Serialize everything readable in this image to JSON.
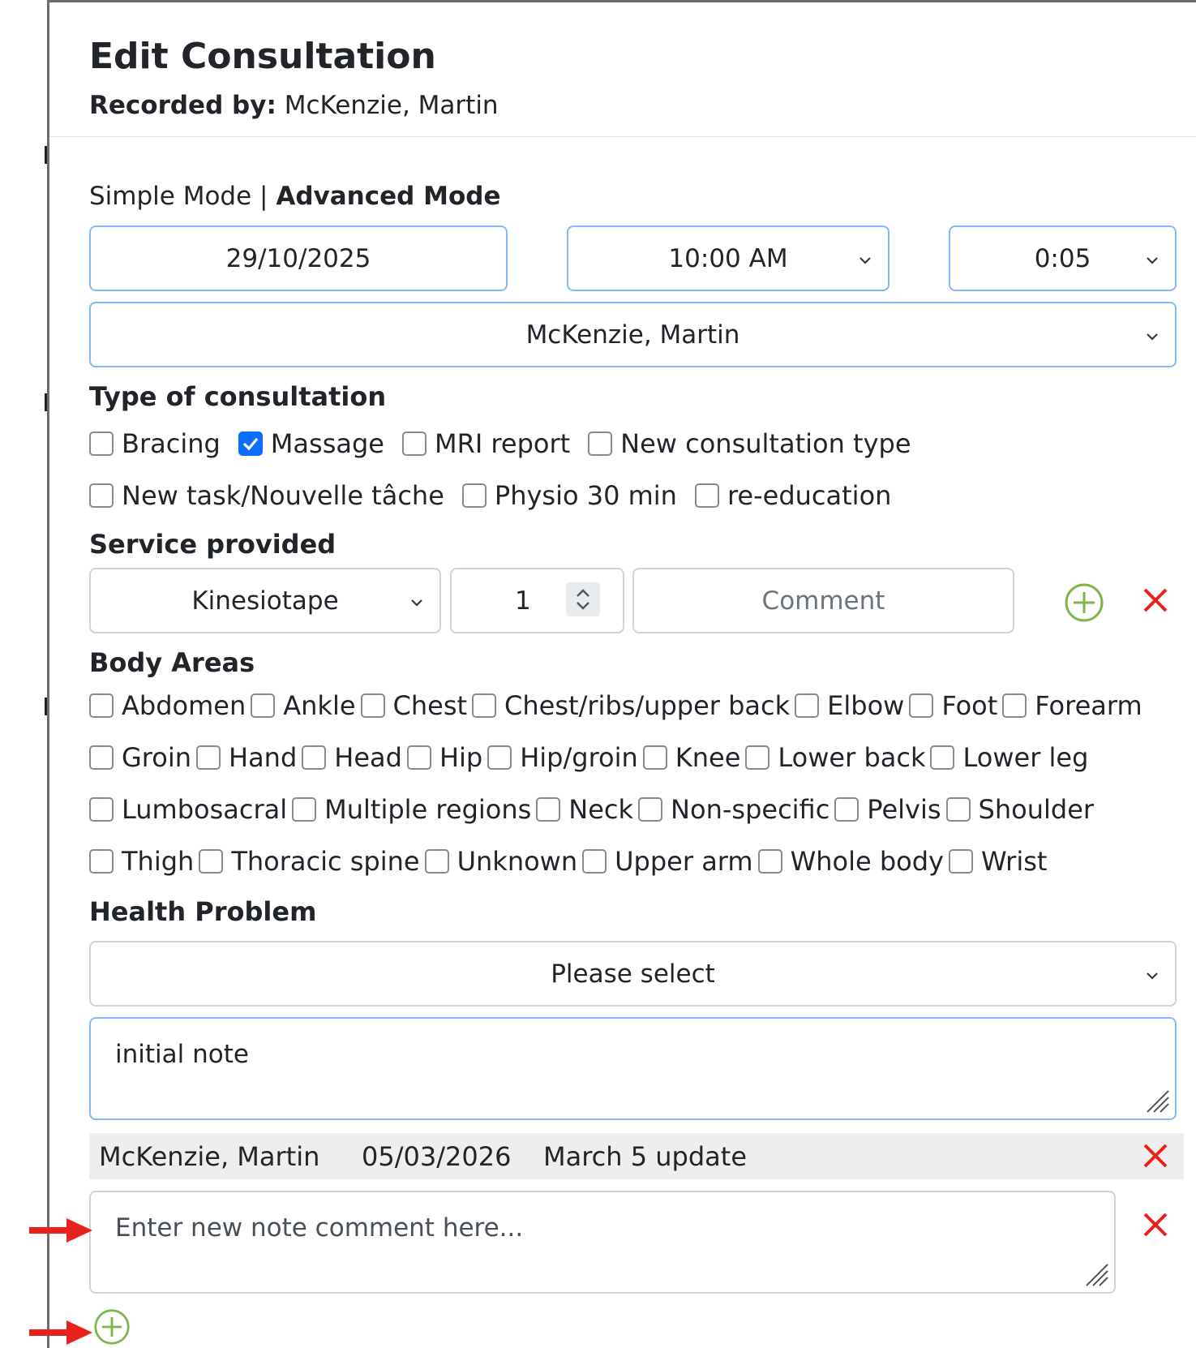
{
  "header": {
    "title": "Edit Consultation",
    "recorded_label": "Recorded by:",
    "recorded_value": "McKenzie, Martin"
  },
  "mode": {
    "simple": "Simple Mode",
    "separator": "|",
    "advanced": "Advanced Mode"
  },
  "date": {
    "value": "29/10/2025"
  },
  "time": {
    "value": "10:00 AM"
  },
  "duration": {
    "value": "0:05"
  },
  "practitioner": {
    "value": "McKenzie, Martin"
  },
  "consultation_type": {
    "label": "Type of consultation",
    "row1": [
      {
        "label": "Bracing",
        "checked": false
      },
      {
        "label": "Massage",
        "checked": true
      },
      {
        "label": "MRI report",
        "checked": false
      },
      {
        "label": "New consultation type",
        "checked": false
      }
    ],
    "row2": [
      {
        "label": "New task/Nouvelle tâche",
        "checked": false
      },
      {
        "label": "Physio 30 min",
        "checked": false
      },
      {
        "label": "re-education",
        "checked": false
      }
    ]
  },
  "service": {
    "label": "Service provided",
    "selected": "Kinesiotape",
    "quantity": "1",
    "comment_placeholder": "Comment"
  },
  "body_areas": {
    "label": "Body Areas",
    "row1": [
      "Abdomen",
      "Ankle",
      "Chest",
      "Chest/ribs/upper back",
      "Elbow",
      "Foot",
      "Forearm"
    ],
    "row2": [
      "Groin",
      "Hand",
      "Head",
      "Hip",
      "Hip/groin",
      "Knee",
      "Lower back",
      "Lower leg"
    ],
    "row3": [
      "Lumbosacral",
      "Multiple regions",
      "Neck",
      "Non-specific",
      "Pelvis",
      "Shoulder"
    ],
    "row4": [
      "Thigh",
      "Thoracic spine",
      "Unknown",
      "Upper arm",
      "Whole body",
      "Wrist"
    ]
  },
  "health_problem": {
    "label": "Health Problem",
    "selected": "Please select"
  },
  "note": {
    "value": "initial note"
  },
  "note_entry": {
    "author": "McKenzie, Martin",
    "date": "05/03/2026",
    "text": "March 5 update"
  },
  "new_comment": {
    "placeholder": "Enter new note comment here..."
  },
  "colors": {
    "accent": "#86b7fe",
    "check": "#0d6efd",
    "add": "#7ab648",
    "delete": "#e8211b",
    "arrow": "#e8211b"
  }
}
